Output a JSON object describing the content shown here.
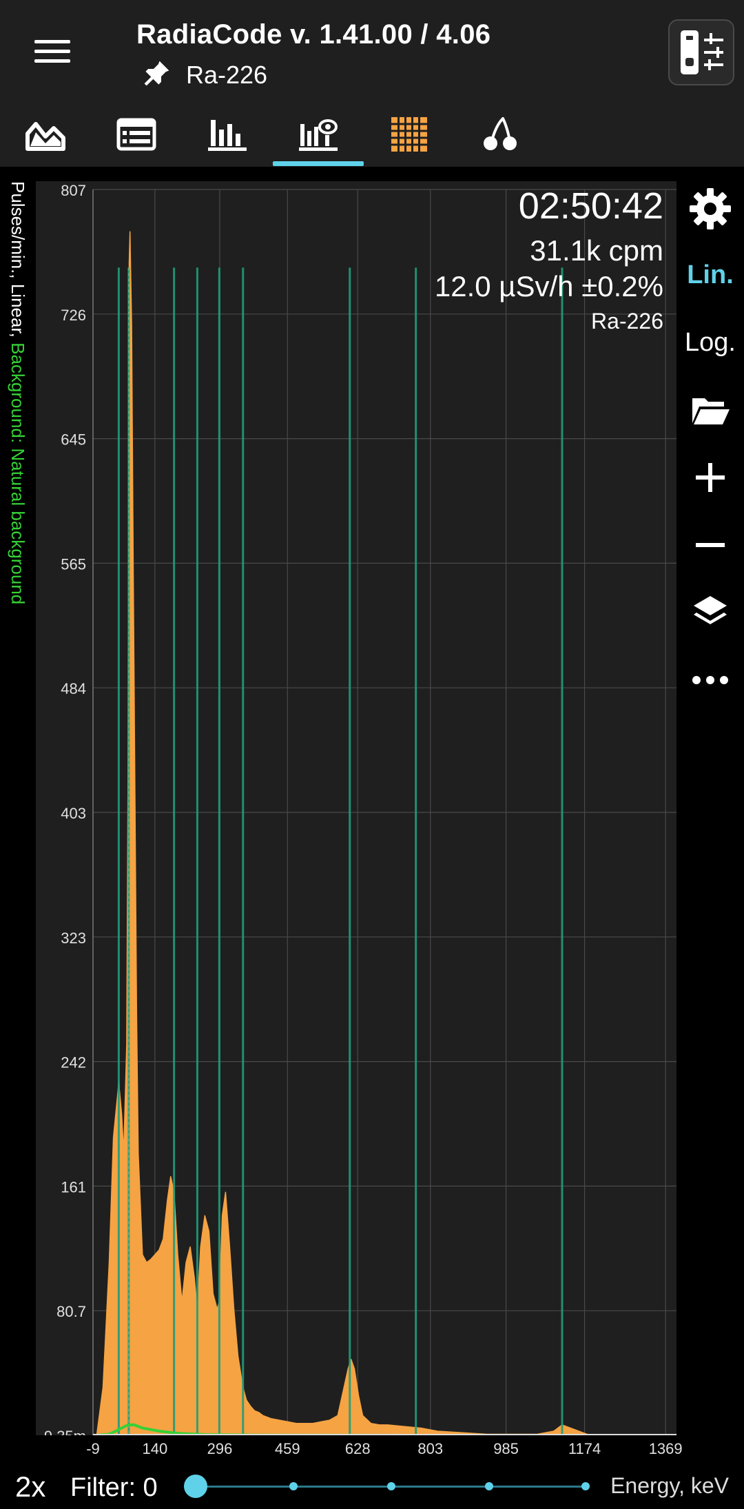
{
  "header": {
    "title": "RadiaCode v. 1.41.00 / 4.06",
    "source_name": "Ra-226"
  },
  "tabs": [
    {
      "name": "tab-dose-rate",
      "icon": "area-chart-icon",
      "active": false
    },
    {
      "name": "tab-history",
      "icon": "table-icon",
      "active": false
    },
    {
      "name": "tab-histogram",
      "icon": "bar-chart-icon",
      "active": false
    },
    {
      "name": "tab-spectrum",
      "icon": "spectrum-icon",
      "active": true
    },
    {
      "name": "tab-grid",
      "icon": "grid-icon",
      "active": false
    },
    {
      "name": "tab-isotopes",
      "icon": "cherry-icon",
      "active": false
    }
  ],
  "colors": {
    "accent": "#5fd2ea",
    "spectrum": "#f5a343",
    "background_curve": "#36d136",
    "isotope_lines": "#1f9d7a",
    "grid_icon": "#f5a343"
  },
  "overlay": {
    "time": "02:50:42",
    "count_rate": "31.1k cpm",
    "dose_rate": "12.0 µSv/h ±0.2%",
    "source": "Ra-226"
  },
  "y_axis_title": {
    "main": "Pulses/min., Linear, ",
    "background": "Background: Natural background"
  },
  "side_panel": {
    "lin_label": "Lin.",
    "log_label": "Log."
  },
  "bottom": {
    "zoom": "2x",
    "filter": "Filter: 0",
    "x_axis_title": "Energy, keV",
    "slider_value": 0
  },
  "chart_data": {
    "type": "area",
    "title": "",
    "xlabel": "Energy, keV",
    "ylabel": "Pulses/min., Linear",
    "scale": "linear",
    "grid": true,
    "xlim": [
      -9,
      1440
    ],
    "ylim": [
      9.35,
      807
    ],
    "x_ticks": [
      "-9",
      "140",
      "296",
      "459",
      "628",
      "803",
      "985",
      "1174",
      "1369"
    ],
    "y_ticks": [
      "807",
      "726",
      "645",
      "565",
      "484",
      "403",
      "323",
      "242",
      "161",
      "80.7",
      "9.35m"
    ],
    "isotope_lines_keV": [
      53,
      77,
      186,
      242,
      295,
      352,
      609,
      768,
      1120
    ],
    "series": [
      {
        "name": "Ra-226",
        "x": [
          0,
          15,
          30,
          40,
          53,
          60,
          65,
          72,
          75,
          78,
          80,
          84,
          88,
          92,
          96,
          100,
          110,
          120,
          130,
          140,
          150,
          160,
          170,
          178,
          186,
          195,
          205,
          215,
          225,
          235,
          242,
          250,
          260,
          270,
          280,
          290,
          295,
          302,
          310,
          320,
          330,
          340,
          352,
          360,
          370,
          380,
          390,
          400,
          420,
          440,
          460,
          480,
          500,
          520,
          540,
          560,
          580,
          595,
          605,
          612,
          620,
          630,
          640,
          660,
          680,
          700,
          740,
          780,
          820,
          880,
          940,
          1000,
          1060,
          1100,
          1120,
          1140,
          1180,
          1240,
          1300,
          1369
        ],
        "values": [
          9.35,
          40,
          120,
          200,
          235,
          215,
          190,
          260,
          420,
          760,
          780,
          720,
          560,
          420,
          280,
          190,
          125,
          120,
          122,
          125,
          128,
          135,
          160,
          175,
          165,
          125,
          95,
          120,
          130,
          110,
          90,
          130,
          150,
          140,
          100,
          90,
          95,
          150,
          165,
          130,
          90,
          60,
          40,
          32,
          28,
          25,
          24,
          22,
          20,
          19,
          18,
          17,
          17,
          17,
          18,
          19,
          22,
          40,
          52,
          58,
          52,
          35,
          22,
          17,
          16,
          16,
          15,
          14,
          12,
          11,
          10,
          10,
          10,
          12,
          16,
          14,
          10,
          8,
          7,
          6
        ]
      },
      {
        "name": "Background: Natural background",
        "x": [
          0,
          30,
          60,
          75,
          90,
          110,
          150,
          200,
          260,
          320,
          400,
          500,
          600,
          800,
          1000,
          1369
        ],
        "values": [
          9.35,
          10,
          14,
          16,
          16,
          14,
          12,
          10.5,
          9.8,
          9.6,
          9.5,
          9.4,
          9.4,
          9.35,
          9.35,
          9.35
        ]
      }
    ]
  }
}
